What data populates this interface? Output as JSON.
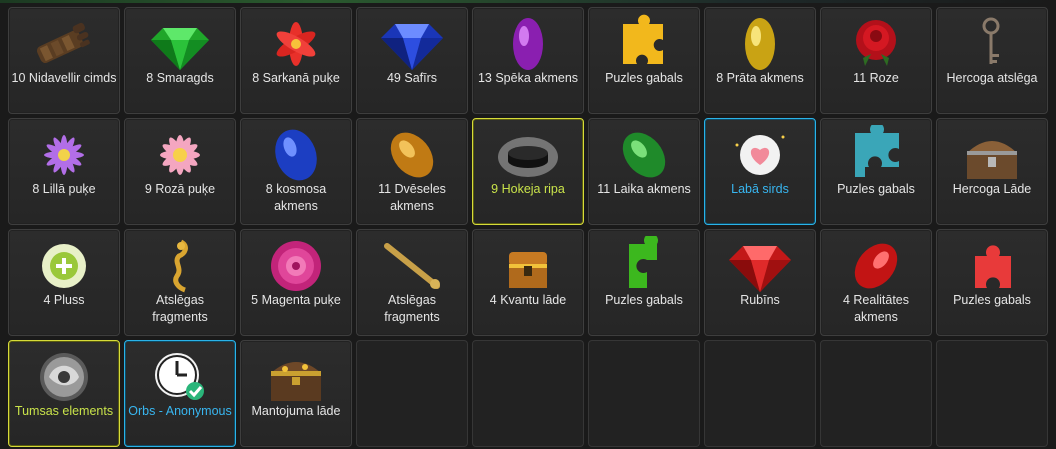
{
  "inventory": {
    "items": [
      {
        "label": "10 Nidavellir cimds",
        "icon": "gauntlet-icon"
      },
      {
        "label": "8 Smaragds",
        "icon": "emerald-gem-icon"
      },
      {
        "label": "8 Sarkanā puķe",
        "icon": "red-lily-icon"
      },
      {
        "label": "49 Safīrs",
        "icon": "sapphire-gem-icon"
      },
      {
        "label": "13 Spēka akmens",
        "icon": "power-stone-icon"
      },
      {
        "label": "Puzles gabals",
        "icon": "puzzle-piece-yellow-icon"
      },
      {
        "label": "8 Prāta akmens",
        "icon": "mind-stone-icon"
      },
      {
        "label": "11 Roze",
        "icon": "rose-icon"
      },
      {
        "label": "Hercoga atslēga",
        "icon": "duke-key-icon"
      },
      {
        "label": "8 Lillā puķe",
        "icon": "lilac-flower-icon"
      },
      {
        "label": "9 Rozā puķe",
        "icon": "pink-flower-icon"
      },
      {
        "label": "8 kosmosa akmens",
        "icon": "space-stone-icon"
      },
      {
        "label": "11 Dvēseles akmens",
        "icon": "soul-stone-icon"
      },
      {
        "label": "9 Hokeja ripa",
        "icon": "hockey-puck-icon",
        "highlight": "yellow"
      },
      {
        "label": "11 Laika akmens",
        "icon": "time-stone-icon"
      },
      {
        "label": "Labā sirds",
        "icon": "heart-bubble-icon",
        "highlight": "blue"
      },
      {
        "label": "Puzles gabals",
        "icon": "puzzle-piece-teal-icon"
      },
      {
        "label": "Hercoga Lāde",
        "icon": "duke-chest-icon"
      },
      {
        "label": "4 Pluss",
        "icon": "plus-orb-icon"
      },
      {
        "label": "Atslēgas fragments",
        "icon": "key-fragment-gold-icon"
      },
      {
        "label": "5 Magenta puķe",
        "icon": "magenta-flower-icon"
      },
      {
        "label": "Atslēgas fragments",
        "icon": "key-fragment-rod-icon"
      },
      {
        "label": "4 Kvantu lāde",
        "icon": "quantum-chest-icon"
      },
      {
        "label": "Puzles gabals",
        "icon": "puzzle-piece-green-icon"
      },
      {
        "label": "Rubīns",
        "icon": "ruby-gem-icon"
      },
      {
        "label": "4 Realitātes akmens",
        "icon": "reality-stone-icon"
      },
      {
        "label": "Puzles gabals",
        "icon": "puzzle-piece-red-icon"
      },
      {
        "label": "Tumsas elements",
        "icon": "darkness-orb-icon",
        "highlight": "yellow"
      },
      {
        "label": "Orbs - Anonymous",
        "icon": "clock-check-icon",
        "highlight": "blue"
      },
      {
        "label": "Mantojuma lāde",
        "icon": "treasure-chest-icon"
      }
    ],
    "total_slots": 36
  },
  "colors": {
    "background": "#1a1a1a",
    "highlight_yellow": "#d6db3a",
    "highlight_blue": "#2bb3e8",
    "label_yellow": "#c9e34a",
    "label_blue": "#38b6f0"
  }
}
